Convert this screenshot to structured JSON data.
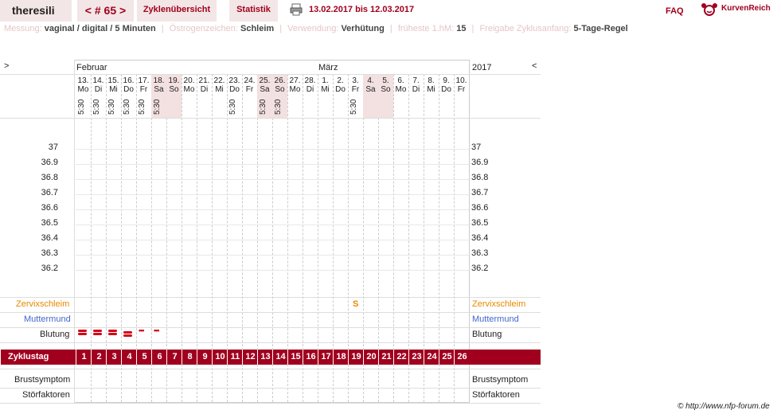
{
  "header": {
    "username": "theresili",
    "cycle_label": "< # 65 >",
    "tab_overview": "Zyklenübersicht",
    "tab_stats": "Statistik",
    "date_range": "13.02.2017 bis 12.03.2017",
    "faq": "FAQ",
    "brand": "KurvenReich"
  },
  "info": {
    "messung_label": "Messung:",
    "messung_value": "vaginal / digital / 5 Minuten",
    "oestrogen_label": "Östrogenzeichen:",
    "oestrogen_value": "Schleim",
    "verwendung_label": "Verwendung:",
    "verwendung_value": "Verhütung",
    "fruehste_label": "früheste 1.hM:",
    "fruehste_value": "15",
    "freigabe_label": "Freigabe Zyklusanfang:",
    "freigabe_value": "5-Tage-Regel"
  },
  "chart": {
    "nav_left": ">",
    "nav_right": "<",
    "month1": "Februar",
    "month2": "März",
    "year": "2017",
    "days": [
      {
        "d": "13.",
        "w": "Mo",
        "t": "5:30"
      },
      {
        "d": "14.",
        "w": "Di",
        "t": "5:30"
      },
      {
        "d": "15.",
        "w": "Mi",
        "t": "5:30"
      },
      {
        "d": "16.",
        "w": "Do",
        "t": "5:30"
      },
      {
        "d": "17.",
        "w": "Fr",
        "t": "5:30"
      },
      {
        "d": "18.",
        "w": "Sa",
        "t": "5:30"
      },
      {
        "d": "19.",
        "w": "So",
        "t": ""
      },
      {
        "d": "20.",
        "w": "Mo",
        "t": ""
      },
      {
        "d": "21.",
        "w": "Di",
        "t": ""
      },
      {
        "d": "22.",
        "w": "Mi",
        "t": ""
      },
      {
        "d": "23.",
        "w": "Do",
        "t": "5:30"
      },
      {
        "d": "24.",
        "w": "Fr",
        "t": ""
      },
      {
        "d": "25.",
        "w": "Sa",
        "t": "5:30"
      },
      {
        "d": "26.",
        "w": "So",
        "t": "5:30"
      },
      {
        "d": "27.",
        "w": "Mo",
        "t": ""
      },
      {
        "d": "28.",
        "w": "Di",
        "t": ""
      },
      {
        "d": "1.",
        "w": "Mi",
        "t": ""
      },
      {
        "d": "2.",
        "w": "Do",
        "t": ""
      },
      {
        "d": "3.",
        "w": "Fr",
        "t": "5:30"
      },
      {
        "d": "4.",
        "w": "Sa",
        "t": ""
      },
      {
        "d": "5.",
        "w": "So",
        "t": ""
      },
      {
        "d": "6.",
        "w": "Mo",
        "t": ""
      },
      {
        "d": "7.",
        "w": "Di",
        "t": ""
      },
      {
        "d": "8.",
        "w": "Mi",
        "t": ""
      },
      {
        "d": "9.",
        "w": "Do",
        "t": ""
      },
      {
        "d": "10.",
        "w": "Fr",
        "t": ""
      }
    ],
    "temps": [
      "37",
      "36.9",
      "36.8",
      "36.7",
      "36.6",
      "36.5",
      "36.4",
      "36.3",
      "36.2"
    ],
    "row_zervix": "Zervixschleim",
    "row_muttermund": "Muttermund",
    "row_blutung": "Blutung",
    "zervix_mark": "S",
    "zervix_mark_day": 19,
    "row_zyklustag": "Zyklustag",
    "row_brust": "Brustsymptom",
    "row_stoer": "Störfaktoren",
    "bleeding": [
      3,
      3,
      3,
      2,
      1,
      1
    ],
    "colors": {
      "accent": "#a0001e",
      "zervix": "#e68a00",
      "muttermund": "#4466cc",
      "blood": "#d40016"
    }
  },
  "footer": {
    "copyright": "© http://www.nfp-forum.de"
  }
}
